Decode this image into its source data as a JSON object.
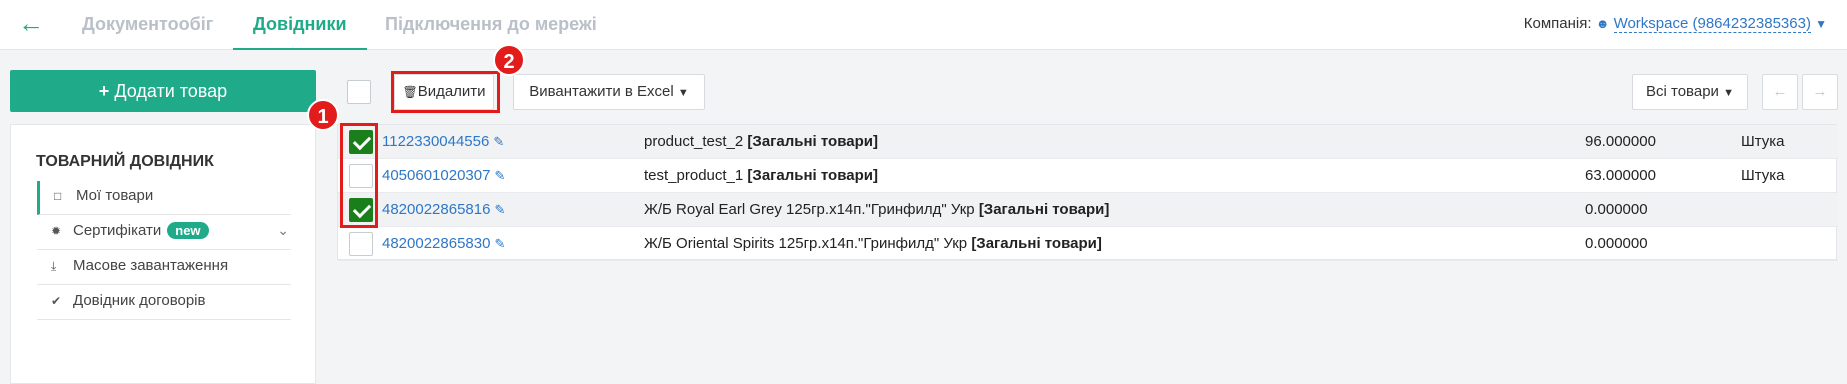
{
  "nav": {
    "back_icon": "arrow-left-icon",
    "tabs": [
      {
        "label": "Документообіг",
        "active": false
      },
      {
        "label": "Довідники",
        "active": true
      },
      {
        "label": "Підключення до мережі",
        "active": false
      }
    ],
    "company_label": "Компанія:",
    "company_value": "Workspace (9864232385363)"
  },
  "sidebar": {
    "add_button": "Додати товар",
    "title": "ТОВАРНИЙ ДОВІДНИК",
    "items": [
      {
        "label": "Мої товари",
        "icon": "box-icon",
        "active": true
      },
      {
        "label": "Сертифікати",
        "icon": "certificate-icon",
        "badge": "new"
      },
      {
        "label": "Масове завантаження",
        "icon": "download-icon"
      },
      {
        "label": "Довідник договорів",
        "icon": "check-icon"
      }
    ]
  },
  "toolbar": {
    "delete_label": "Видалити",
    "export_label": "Вивантажити в Excel",
    "filter_label": "Всі товари"
  },
  "products": [
    {
      "code": "1122330044556",
      "name": "product_test_2",
      "category": "[Загальні товари]",
      "qty": "96.000000",
      "unit": "Штука",
      "checked": true
    },
    {
      "code": "4050601020307",
      "name": "test_product_1",
      "category": "[Загальні товари]",
      "qty": "63.000000",
      "unit": "Штука",
      "checked": false
    },
    {
      "code": "4820022865816",
      "name": "Ж/Б Royal Earl Grey 125гр.х14п.\"Гринфилд\" Укр",
      "category": "[Загальні товари]",
      "qty": "0.000000",
      "unit": "",
      "checked": true
    },
    {
      "code": "4820022865830",
      "name": "Ж/Б Oriental Spirits 125гр.х14п.\"Гринфилд\" Укр",
      "category": "[Загальні товари]",
      "qty": "0.000000",
      "unit": "",
      "checked": false
    }
  ],
  "annotations": {
    "marker1": "1",
    "marker2": "2"
  },
  "colors": {
    "accent": "#1fab89",
    "link": "#2f77c7",
    "highlight": "#e21b1b"
  }
}
